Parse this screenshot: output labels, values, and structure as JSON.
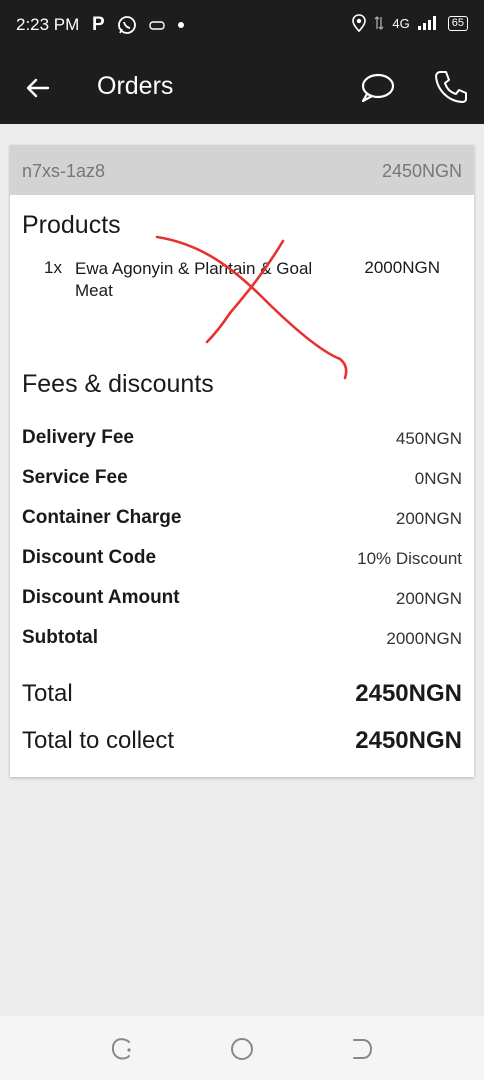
{
  "status_bar": {
    "time": "2:23 PM",
    "app_badge": "P",
    "network": "4G",
    "battery": "65"
  },
  "app_bar": {
    "title": "Orders",
    "back_icon": "arrow-left-icon",
    "chat_icon": "chat-bubble-icon",
    "phone_icon": "phone-icon"
  },
  "order": {
    "id": "n7xs-1az8",
    "header_total": "2450NGN",
    "products_title": "Products",
    "products": [
      {
        "qty": "1x",
        "name": "Ewa Agonyin & Plantain & Goal Meat",
        "price": "2000NGN"
      }
    ],
    "fees_title": "Fees & discounts",
    "fees": [
      {
        "label": "Delivery Fee",
        "value": "450NGN"
      },
      {
        "label": "Service Fee",
        "value": "0NGN"
      },
      {
        "label": "Container Charge",
        "value": "200NGN"
      },
      {
        "label": "Discount Code",
        "value": "10% Discount"
      },
      {
        "label": "Discount Amount",
        "value": "200NGN"
      },
      {
        "label": "Subtotal",
        "value": "2000NGN"
      }
    ],
    "total": {
      "label": "Total",
      "value": "2450NGN"
    },
    "total_to_collect": {
      "label": "Total to collect",
      "value": "2450NGN"
    }
  },
  "colors": {
    "bar_background": "#1d1d1d",
    "page_background": "#ececec",
    "card_header": "#d3d3d3",
    "annotation_stroke": "#e8312f"
  }
}
